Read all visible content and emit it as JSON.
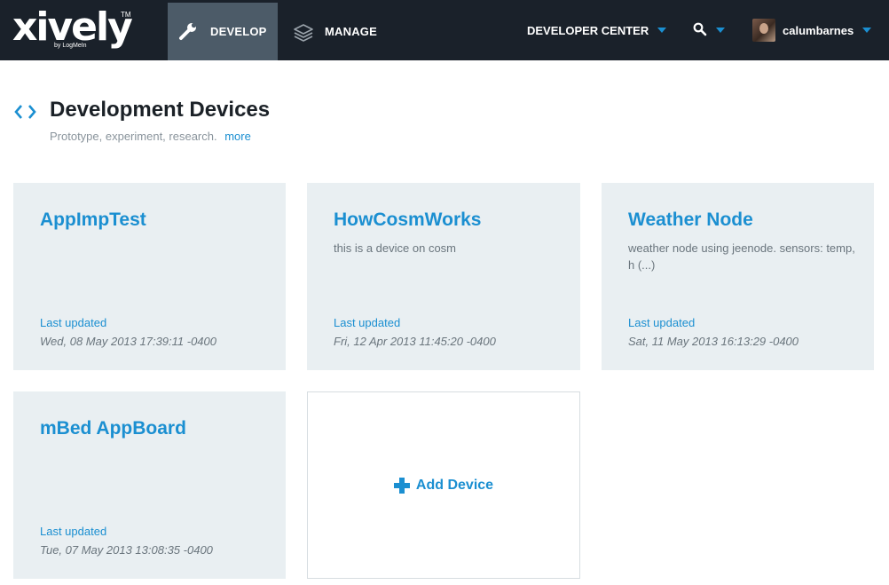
{
  "header": {
    "logo": {
      "text": "xively",
      "tm": "TM",
      "byline": "by LogMeIn"
    },
    "tabs": [
      {
        "label": "DEVELOP",
        "icon": "wrench-icon",
        "active": true
      },
      {
        "label": "MANAGE",
        "icon": "layers-icon",
        "active": false
      }
    ],
    "developer_center": "DEVELOPER CENTER",
    "search_icon": "search-icon",
    "user": {
      "name": "calumbarnes",
      "avatar": "user-avatar"
    },
    "colors": {
      "bar": "#1a212a",
      "active_tab": "#4c5b68",
      "accent": "#1b8fd1"
    }
  },
  "page": {
    "icon": "code-brackets-icon",
    "title": "Development Devices",
    "subtitle": "Prototype, experiment, research.",
    "more_link": "more"
  },
  "devices": [
    {
      "name": "AppImpTest",
      "description": "",
      "last_updated_label": "Last updated",
      "last_updated": "Wed, 08 May 2013 17:39:11 -0400"
    },
    {
      "name": "HowCosmWorks",
      "description": "this is a device on cosm",
      "last_updated_label": "Last updated",
      "last_updated": "Fri, 12 Apr 2013 11:45:20 -0400"
    },
    {
      "name": "Weather Node",
      "description": "weather node using jeenode. sensors: temp, h (...)",
      "last_updated_label": "Last updated",
      "last_updated": "Sat, 11 May 2013 16:13:29 -0400"
    },
    {
      "name": "mBed AppBoard",
      "description": "",
      "last_updated_label": "Last updated",
      "last_updated": "Tue, 07 May 2013 13:08:35 -0400"
    }
  ],
  "add_device": {
    "label": "Add Device",
    "icon": "plus-icon"
  }
}
